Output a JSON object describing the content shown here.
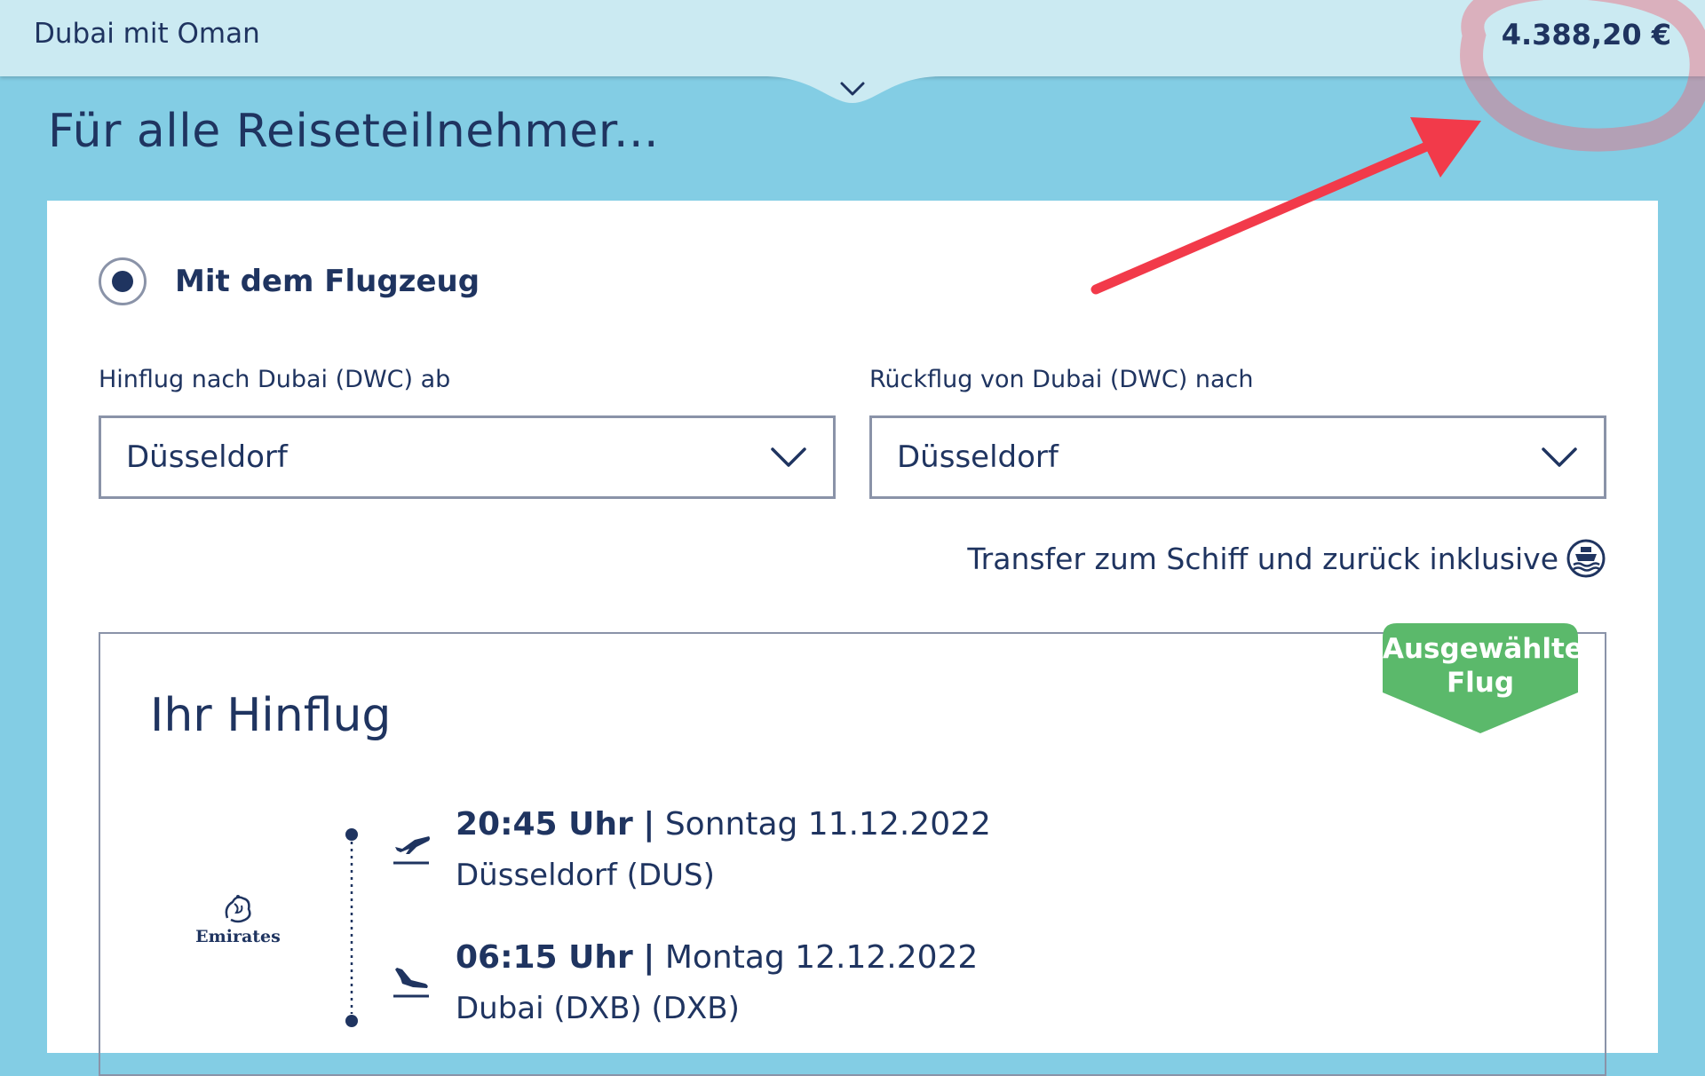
{
  "header": {
    "trip_name": "Dubai mit Oman",
    "price": "4.388,20 €"
  },
  "page": {
    "heading": "Für alle Reiseteilnehmer..."
  },
  "travel_mode": {
    "label": "Mit dem Flugzeug",
    "selected": true
  },
  "outbound": {
    "label": "Hinflug nach Dubai (DWC) ab",
    "value": "Düsseldorf"
  },
  "return": {
    "label": "Rückflug von Dubai (DWC) nach",
    "value": "Düsseldorf"
  },
  "transfer": {
    "text": "Transfer zum Schiff und zurück inklusive",
    "icon": "ship-icon"
  },
  "flight": {
    "title": "Ihr Hinflug",
    "badge_line1": "Ausgewählter",
    "badge_line2": "Flug",
    "airline": "Emirates",
    "departure": {
      "time": "20:45 Uhr",
      "separator": "|",
      "date": "Sonntag 11.12.2022",
      "place": "Düsseldorf (DUS)"
    },
    "arrival": {
      "time": "06:15 Uhr",
      "separator": "|",
      "date": "Montag 12.12.2022",
      "place": "Dubai (DXB) (DXB)"
    }
  },
  "colors": {
    "navy": "#1f3460",
    "sky": "#83cde4",
    "header_bg": "#cbeaf2",
    "badge_green": "#5bb96b",
    "annotation_red": "#f23a4a"
  }
}
